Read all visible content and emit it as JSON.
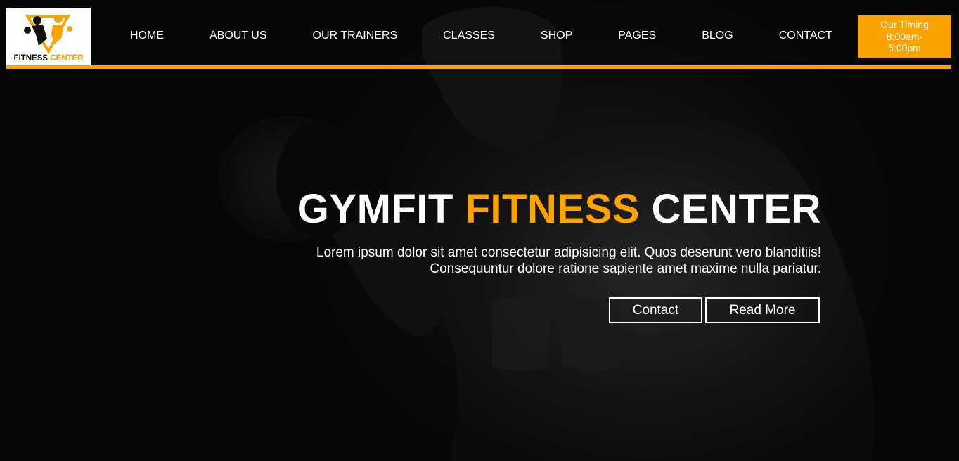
{
  "logo": {
    "text_dark": "FITNESS",
    "text_accent": "CENTER",
    "icon": "fitness-figures-logo"
  },
  "nav": {
    "items": [
      "HOME",
      "ABOUT US",
      "OUR TRAINERS",
      "CLASSES",
      "SHOP",
      "PAGES",
      "BLOG",
      "CONTACT"
    ]
  },
  "timing": {
    "line1": "Our Timing",
    "line2": "8:00am-",
    "line3": "5:00pm"
  },
  "hero": {
    "title_part1": "GYMFIT",
    "title_accent": "FITNESS",
    "title_part2": "CENTER",
    "desc_line1": "Lorem ipsum dolor sit amet consectetur adipisicing elit. Quos deserunt vero blanditiis!",
    "desc_line2": "Consequuntur dolore ratione sapiente amet maxime nulla pariatur.",
    "contact_button": "Contact",
    "read_more_button": "Read More",
    "background_image": "man-lifting-dumbbell-dark"
  },
  "colors": {
    "accent": "#fba300",
    "background": "#0b0b0b",
    "text": "#ffffff"
  }
}
